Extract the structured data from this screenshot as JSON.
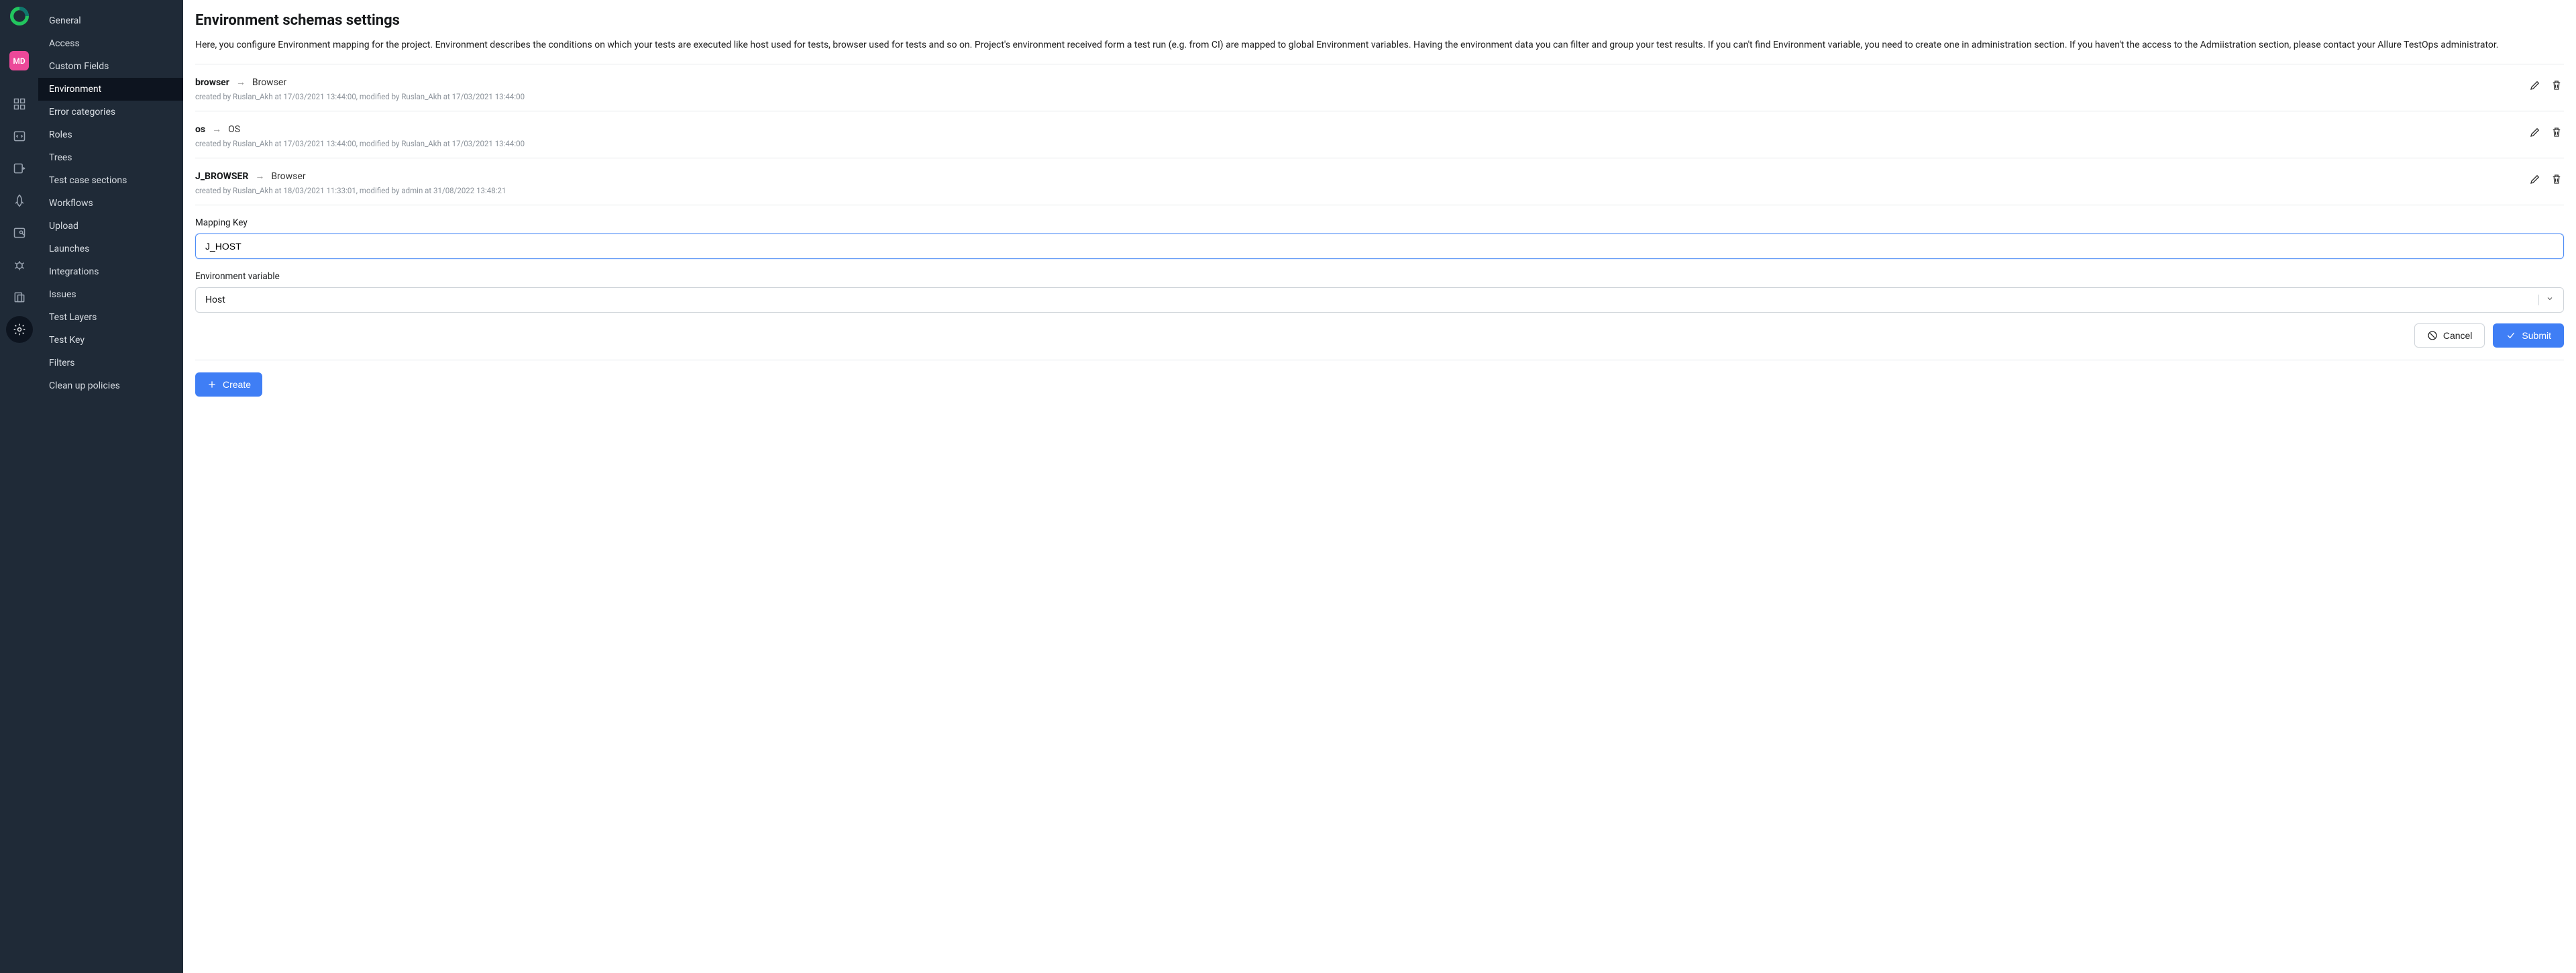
{
  "rail": {
    "avatar_initials": "MD"
  },
  "sidenav": {
    "items": [
      {
        "label": "General"
      },
      {
        "label": "Access"
      },
      {
        "label": "Custom Fields"
      },
      {
        "label": "Environment"
      },
      {
        "label": "Error categories"
      },
      {
        "label": "Roles"
      },
      {
        "label": "Trees"
      },
      {
        "label": "Test case sections"
      },
      {
        "label": "Workflows"
      },
      {
        "label": "Upload"
      },
      {
        "label": "Launches"
      },
      {
        "label": "Integrations"
      },
      {
        "label": "Issues"
      },
      {
        "label": "Test Layers"
      },
      {
        "label": "Test Key"
      },
      {
        "label": "Filters"
      },
      {
        "label": "Clean up policies"
      }
    ],
    "active_index": 3
  },
  "page": {
    "title": "Environment schemas settings",
    "description": "Here, you configure Environment mapping for the project. Environment describes the conditions on which your tests are executed like host used for tests, browser used for tests and so on. Project's environment received form a test run (e.g. from CI) are mapped to global Environment variables. Having the environment data you can filter and group your test results. If you can't find Environment variable, you need to create one in administration section. If you haven't the access to the Admiistration section, please contact your Allure TestOps administrator."
  },
  "mappings": [
    {
      "key": "browser",
      "value": "Browser",
      "meta": "created by Ruslan_Akh at 17/03/2021 13:44:00, modified by Ruslan_Akh at 17/03/2021 13:44:00"
    },
    {
      "key": "os",
      "value": "OS",
      "meta": "created by Ruslan_Akh at 17/03/2021 13:44:00, modified by Ruslan_Akh at 17/03/2021 13:44:00"
    },
    {
      "key": "J_BROWSER",
      "value": "Browser",
      "meta": "created by Ruslan_Akh at 18/03/2021 11:33:01, modified by admin at 31/08/2022 13:48:21"
    }
  ],
  "form": {
    "mapping_key_label": "Mapping Key",
    "mapping_key_value": "J_HOST",
    "env_var_label": "Environment variable",
    "env_var_value": "Host",
    "cancel_label": "Cancel",
    "submit_label": "Submit",
    "create_label": "Create"
  }
}
